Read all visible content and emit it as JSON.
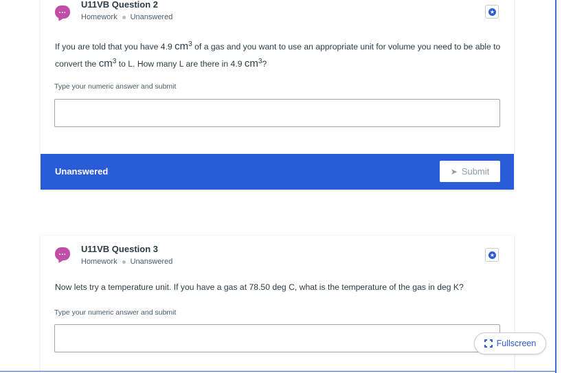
{
  "colors": {
    "accent": "#2a5cd8",
    "chat_icon": "#c14fa6",
    "text": "#2d3b45"
  },
  "questions": [
    {
      "title": "U11VB Question 2",
      "category": "Homework",
      "status": "Unanswered",
      "icon": "chat-bubble-icon",
      "prompt_parts": [
        "If you are told that you have 4.9 ",
        "cm",
        "3",
        " of a gas and you want to use an appropriate unit for volume you need to be able to convert the ",
        "cm",
        "3",
        " to L. How many L are there in 4.9 ",
        "cm",
        "3",
        "?"
      ],
      "hint": "Type your numeric answer and submit",
      "answer_value": "",
      "footer_status": "Unanswered",
      "submit_label": "Submit"
    },
    {
      "title": "U11VB Question 3",
      "category": "Homework",
      "status": "Unanswered",
      "icon": "chat-bubble-icon",
      "prompt": "Now lets try a temperature unit. If you have a gas at 78.50 deg C, what is the temperature of the gas in deg K?",
      "hint": "Type your numeric answer and submit",
      "answer_value": ""
    }
  ],
  "chat_icon_text": "...",
  "star_icon_text": "★",
  "send_icon_text": "➤",
  "fullscreen_label": "Fullscreen"
}
